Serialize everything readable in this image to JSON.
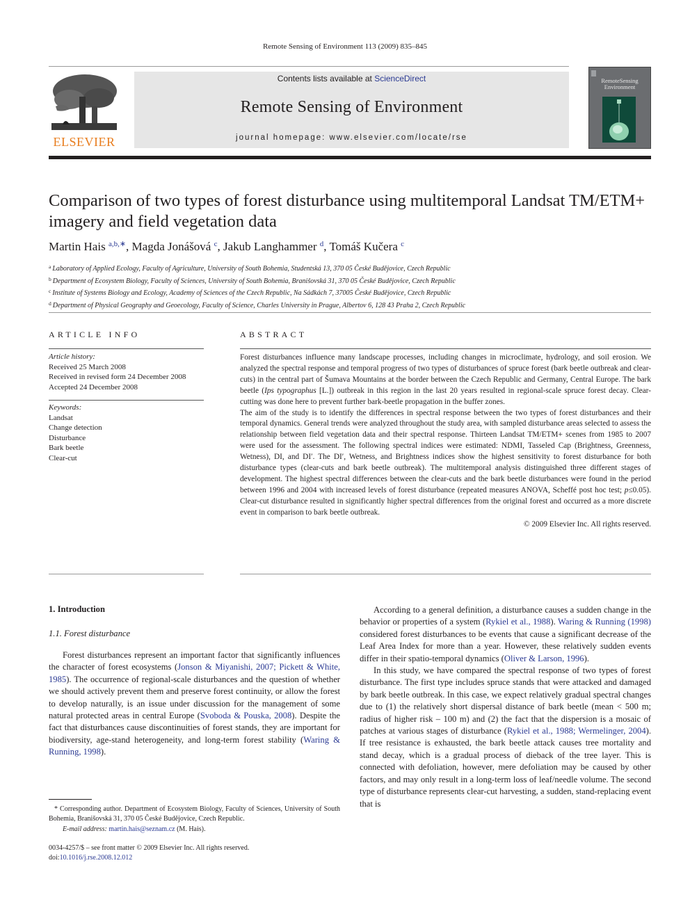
{
  "running_head": "Remote Sensing of Environment 113 (2009) 835–845",
  "header": {
    "publisher_logo_text": "ELSEVIER",
    "contents_prefix": "Contents lists available at ",
    "contents_link": "ScienceDirect",
    "journal_name": "Remote Sensing of Environment",
    "homepage": "journal homepage: www.elsevier.com/locate/rse",
    "cover_title_line1": "RemoteSensing",
    "cover_title_line2": "Environment",
    "colors": {
      "publisher_orange": "#e87d1e",
      "banner_bg": "#e6e6e6",
      "link_blue": "#2b3a93",
      "cover_green": "#0f4a3a"
    }
  },
  "article": {
    "title": "Comparison of two types of forest disturbance using multitemporal Landsat TM/ETM+ imagery and field vegetation data",
    "authors": [
      {
        "name": "Martin Hais",
        "sup": "a,b,∗",
        "sep": ", "
      },
      {
        "name": "Magda Jonášová",
        "sup": "c",
        "sep": ", "
      },
      {
        "name": "Jakub Langhammer",
        "sup": "d",
        "sep": ", "
      },
      {
        "name": "Tomáš Kučera",
        "sup": "c",
        "sep": ""
      }
    ],
    "affiliations": [
      {
        "key": "a",
        "text": "Laboratory of Applied Ecology, Faculty of Agriculture, University of South Bohemia, Studentská 13, 370 05 České Budějovice, Czech Republic"
      },
      {
        "key": "b",
        "text": "Department of Ecosystem Biology, Faculty of Sciences, University of South Bohemia, Branišovská 31, 370 05 České Budějovice, Czech Republic"
      },
      {
        "key": "c",
        "text": "Institute of Systems Biology and Ecology, Academy of Sciences of the Czech Republic, Na Sádkách 7, 37005 České Budějovice, Czech Republic"
      },
      {
        "key": "d",
        "text": "Department of Physical Geography and Geoecology, Faculty of Science, Charles University in Prague, Albertov 6, 128 43 Praha 2, Czech Republic"
      }
    ]
  },
  "article_info": {
    "label": "ARTICLE INFO",
    "history_heading": "Article history:",
    "history": [
      "Received 25 March 2008",
      "Received in revised form 24 December 2008",
      "Accepted 24 December 2008"
    ],
    "keywords_heading": "Keywords:",
    "keywords": [
      "Landsat",
      "Change detection",
      "Disturbance",
      "Bark beetle",
      "Clear-cut"
    ]
  },
  "abstract": {
    "label": "ABSTRACT",
    "p1_a": "Forest disturbances influence many landscape processes, including changes in microclimate, hydrology, and soil erosion. We analyzed the spectral response and temporal progress of two types of disturbances of spruce forest (bark beetle outbreak and clear-cuts) in the central part of Šumava Mountains at the border between the Czech Republic and Germany, Central Europe. The bark beetle (",
    "p1_species": "Ips typographus",
    "p1_b": " [L.]) outbreak in this region in the last 20 years resulted in regional-scale spruce forest decay. Clear-cutting was done here to prevent further bark-beetle propagation in the buffer zones.",
    "p2_a": "The aim of the study is to identify the differences in spectral response between the two types of forest disturbances and their temporal dynamics. General trends were analyzed throughout the study area, with sampled disturbance areas selected to assess the relationship between field vegetation data and their spectral response. Thirteen Landsat TM/ETM+ scenes from 1985 to 2007 were used for the assessment. The following spectral indices were estimated: NDMI, Tasseled Cap (Brightness, Greenness, Wetness), DI, and DI′. The DI′, Wetness, and Brightness indices show the highest sensitivity to forest disturbance for both disturbance types (clear-cuts and bark beetle outbreak). The multitemporal analysis distinguished three different stages of development. The highest spectral differences between the clear-cuts and the bark beetle disturbances were found in the period between 1996 and 2004 with increased levels of forest disturbance (repeated measures ANOVA, Scheffé post hoc test; ",
    "p2_p": "p",
    "p2_b": "≤0.05). Clear-cut disturbance resulted in significantly higher spectral differences from the original forest and occurred as a more discrete event in comparison to bark beetle outbreak.",
    "rights": "© 2009 Elsevier Inc. All rights reserved."
  },
  "body": {
    "section_heading": "1. Introduction",
    "subsection_heading": "1.1. Forest disturbance",
    "left_p1": [
      {
        "t": "Forest disturbances represent an important factor that significantly influences the character of forest ecosystems ("
      },
      {
        "ref": "Jonson & Miyanishi, 2007; Pickett & White, 1985"
      },
      {
        "t": "). The occurrence of regional-scale disturbances and the question of whether we should actively prevent them and preserve forest continuity, or allow the forest to develop naturally, is an issue under discussion for the management of some natural protected areas in central Europe ("
      },
      {
        "ref": "Svoboda & Pouska, 2008"
      },
      {
        "t": "). Despite the fact that disturbances cause discontinuities of forest stands, they are important for biodiversity, age-stand heterogeneity, and long-term forest stability ("
      },
      {
        "ref": "Waring & Running, 1998"
      },
      {
        "t": ")."
      }
    ],
    "right_p1": [
      {
        "t": "According to a general definition, a disturbance causes a sudden change in the behavior or properties of a system ("
      },
      {
        "ref": "Rykiel et al., 1988"
      },
      {
        "t": "). "
      },
      {
        "ref": "Waring & Running (1998)"
      },
      {
        "t": " considered forest disturbances to be events that cause a significant decrease of the Leaf Area Index for more than a year. However, these relatively sudden events differ in their spatio-temporal dynamics ("
      },
      {
        "ref": "Oliver & Larson, 1996"
      },
      {
        "t": ")."
      }
    ],
    "right_p2": [
      {
        "t": "In this study, we have compared the spectral response of two types of forest disturbance. The first type includes spruce stands that were attacked and damaged by bark beetle outbreak. In this case, we expect relatively gradual spectral changes due to (1) the relatively short dispersal distance of bark beetle (mean < 500 m; radius of higher risk – 100 m) and (2) the fact that the dispersion is a mosaic of patches at various stages of disturbance ("
      },
      {
        "ref": "Rykiel et al., 1988; Wermelinger, 2004"
      },
      {
        "t": "). If tree resistance is exhausted, the bark beetle attack causes tree mortality and stand decay, which is a gradual process of dieback of the tree layer. This is connected with defoliation, however, mere defoliation may be caused by other factors, and may only result in a long-term loss of leaf/needle volume. The second type of disturbance represents clear-cut harvesting, a sudden, stand-replacing event that is"
      }
    ]
  },
  "footnote": {
    "corresponding": "* Corresponding author. Department of Ecosystem Biology, Faculty of Sciences, University of South Bohemia, Branišovská 31, 370 05 České Budějovice, Czech Republic.",
    "email_label": "E-mail address:",
    "email": "martin.hais@seznam.cz",
    "email_suffix": " (M. Hais).",
    "issn": "0034-4257/$ – see front matter © 2009 Elsevier Inc. All rights reserved.",
    "doi_label": "doi:",
    "doi": "10.1016/j.rse.2008.12.012"
  }
}
